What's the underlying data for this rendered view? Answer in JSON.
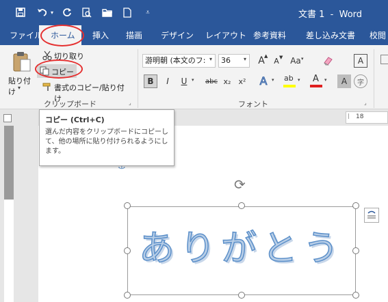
{
  "title_bar": {
    "title": "文書 1  -  Word",
    "quick_access": [
      "save-icon",
      "undo-icon",
      "redo-icon",
      "print-preview-icon",
      "open-folder-icon",
      "new-document-icon",
      "customize-qat-icon"
    ]
  },
  "tabs": [
    {
      "id": "file",
      "label": "ファイル"
    },
    {
      "id": "home",
      "label": "ホーム",
      "active": true
    },
    {
      "id": "insert",
      "label": "挿入"
    },
    {
      "id": "draw",
      "label": "描画"
    },
    {
      "id": "design",
      "label": "デザイン"
    },
    {
      "id": "layout",
      "label": "レイアウト"
    },
    {
      "id": "references",
      "label": "参考資料"
    },
    {
      "id": "mailings",
      "label": "差し込み文書"
    },
    {
      "id": "review",
      "label": "校閲"
    }
  ],
  "clipboard": {
    "paste_label": "貼り付け",
    "cut_label": "切り取り",
    "copy_label": "コピー",
    "format_painter_label": "書式のコピー/貼り付け",
    "group_label": "クリップボード"
  },
  "font": {
    "font_name": "游明朝 (本文のフ:",
    "font_size": "36",
    "group_label": "フォント",
    "grow_label": "A",
    "shrink_label": "A",
    "case_label": "Aa",
    "bold_label": "B",
    "italic_label": "I",
    "underline_label": "U",
    "strike_label": "abc",
    "subscript_label": "x₂",
    "superscript_label": "x²",
    "text_effect_label": "A",
    "highlight_label": "ab",
    "font_color_label": "A",
    "char_shading_label": "A",
    "enclose_label": "字",
    "char_border_label": "A"
  },
  "tooltip": {
    "title": "コピー (Ctrl+C)",
    "description": "選んだ内容をクリップボードにコピーして、他の場所に貼り付けられるようにします。"
  },
  "ruler": {
    "marker": "18"
  },
  "document": {
    "wordart_text": "ありがとう"
  },
  "colors": {
    "ribbon_blue": "#2b579a",
    "annotation_red": "#e53030",
    "wordart_fill": "#b8cee7",
    "wordart_outline": "#5b8fc9",
    "highlight_yellow": "#ffff00",
    "font_color_red": "#e02020"
  }
}
